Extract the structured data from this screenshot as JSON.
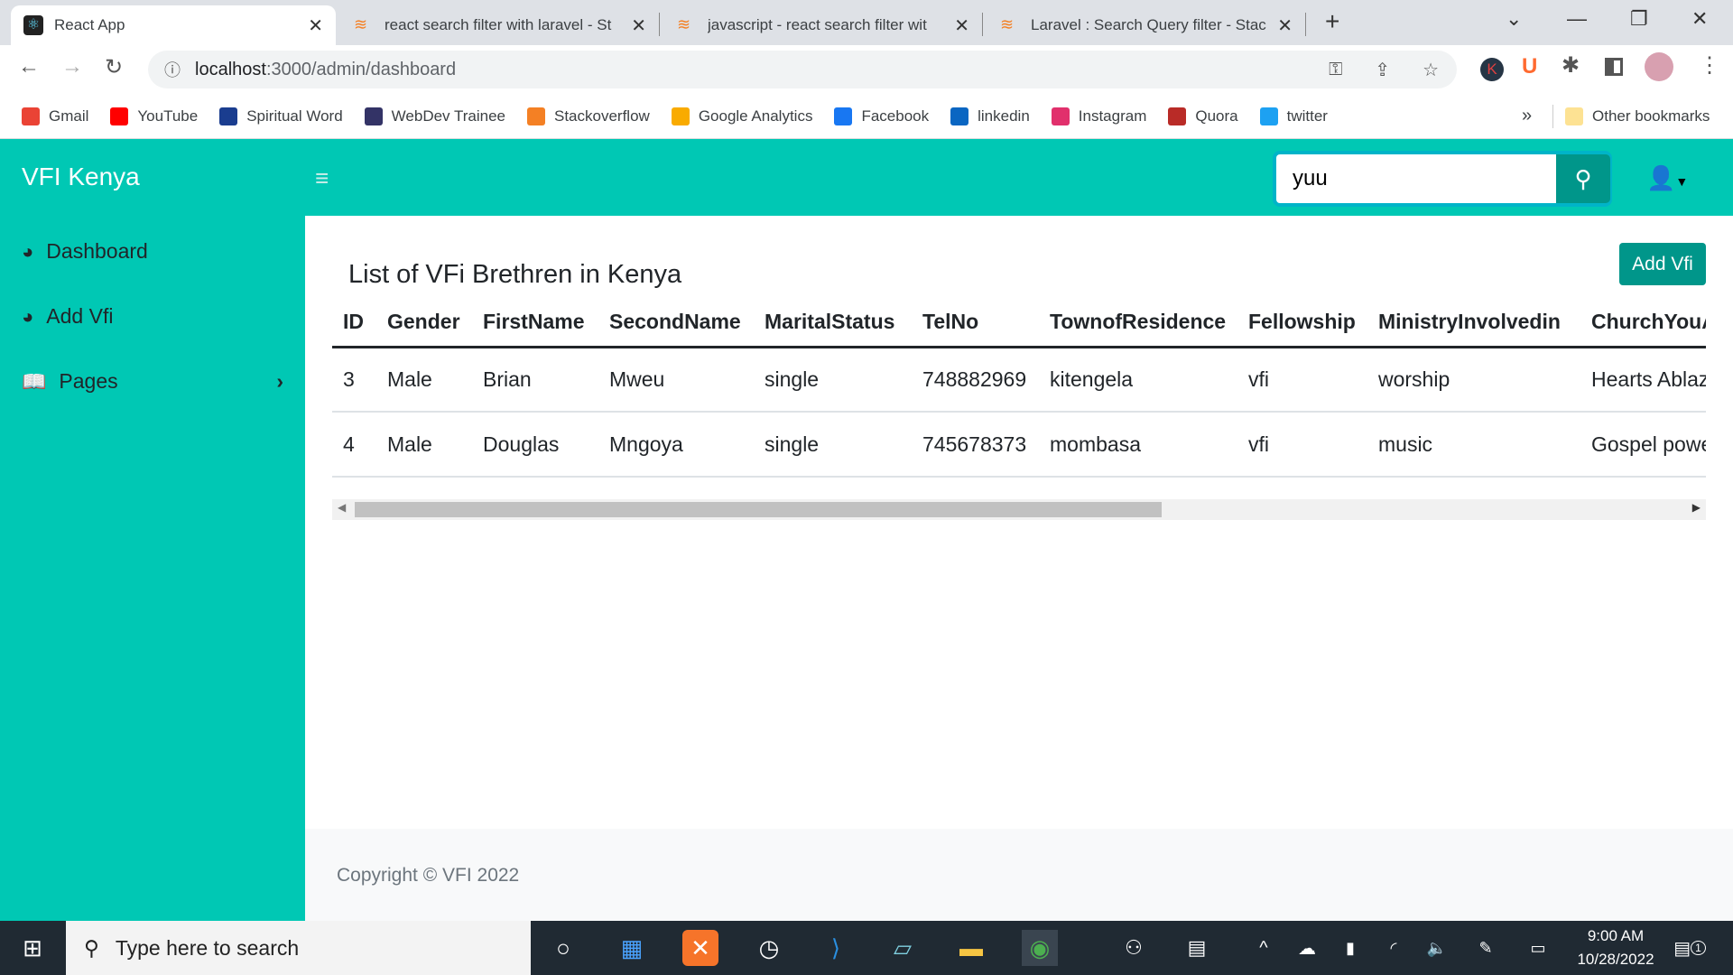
{
  "browser": {
    "tabs": [
      {
        "title": "React App",
        "icon": "react-icon"
      },
      {
        "title": "react search filter with laravel - St",
        "icon": "stackoverflow-icon"
      },
      {
        "title": "javascript - react search filter wit",
        "icon": "stackoverflow-icon"
      },
      {
        "title": "Laravel : Search Query filter - Stac",
        "icon": "stackoverflow-icon"
      }
    ],
    "url_host": "localhost",
    "url_path": ":3000/admin/dashboard",
    "bookmarks": [
      {
        "label": "Gmail",
        "color": "#ea4335"
      },
      {
        "label": "YouTube",
        "color": "#ff0000"
      },
      {
        "label": "Spiritual Word",
        "color": "#1a3d8f"
      },
      {
        "label": "WebDev Trainee",
        "color": "#333366"
      },
      {
        "label": "Stackoverflow",
        "color": "#f48024"
      },
      {
        "label": "Google Analytics",
        "color": "#f9ab00"
      },
      {
        "label": "Facebook",
        "color": "#1877f2"
      },
      {
        "label": "linkedin",
        "color": "#0a66c2"
      },
      {
        "label": "Instagram",
        "color": "#e1306c"
      },
      {
        "label": "Quora",
        "color": "#b92b27"
      },
      {
        "label": "twitter",
        "color": "#1da1f2"
      }
    ],
    "more_bookmarks": "»",
    "other_bookmarks": "Other bookmarks"
  },
  "app": {
    "brand": "VFI Kenya",
    "accent": "#00c8b4",
    "search_value": "yuu",
    "sidebar": [
      {
        "label": "Dashboard",
        "icon": "tachometer-icon"
      },
      {
        "label": "Add Vfi",
        "icon": "tachometer-icon"
      },
      {
        "label": "Pages",
        "icon": "book-open-icon"
      }
    ],
    "title": "List of VFi Brethren in Kenya",
    "add_button": "Add Vfi",
    "table": {
      "columns": [
        "ID",
        "Gender",
        "FirstName",
        "SecondName",
        "MaritalStatus",
        "TelNo",
        "TownofResidence",
        "Fellowship",
        "MinistryInvolvedin",
        "ChurchYouA"
      ],
      "rows": [
        [
          "3",
          "Male",
          "Brian",
          "Mweu",
          "single",
          "748882969",
          "kitengela",
          "vfi",
          "worship",
          "Hearts Ablaze"
        ],
        [
          "4",
          "Male",
          "Douglas",
          "Mngoya",
          "single",
          "745678373",
          "mombasa",
          "vfi",
          "music",
          "Gospel power"
        ]
      ]
    },
    "footer": "Copyright © VFI 2022"
  },
  "taskbar": {
    "search_placeholder": "Type here to search",
    "time": "9:00 AM",
    "date": "10/28/2022",
    "notifications": "1"
  }
}
